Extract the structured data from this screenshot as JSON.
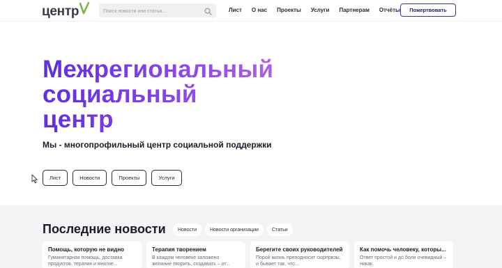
{
  "header": {
    "logo_text": "центр",
    "logo_mark": "V",
    "search_placeholder": "Поиск новости или статьи...",
    "nav": [
      "Лист",
      "О нас",
      "Проекты",
      "Услуги",
      "Партнерам",
      "Отчёты"
    ],
    "donate_label": "Пожертвовать"
  },
  "hero": {
    "title_lines": [
      "Межрегиональный",
      "социальный",
      "центр"
    ],
    "subtitle": "Мы - многопрофильный центр социальной поддержки",
    "buttons": [
      "Лист",
      "Новости",
      "Проекты",
      "Услуги"
    ]
  },
  "news": {
    "title": "Последние новости",
    "filters": [
      "Новости",
      "Новости организации",
      "Статьи"
    ],
    "cards": [
      {
        "title": "Помощь, которую не видно",
        "text": "Гуманитарная помощь, доставка продуктов, терапия и многие..."
      },
      {
        "title": "Терапия творением",
        "text": "В каждом человеке заложено желание творить, создавать – от..."
      },
      {
        "title": "Берегите своих руководителей",
        "text": "Порой жизнь преподносит сюрпризы, и бывает так, что..."
      },
      {
        "title": "Как помочь человеку, которы...",
        "text": "Ответ простой и до боли очевидный – никак."
      }
    ]
  },
  "colors": {
    "gradient_start": "#5e2ee0",
    "gradient_end": "#c46ee8",
    "logo_green": "#7ab648",
    "donate_border": "#2f3a8f"
  }
}
